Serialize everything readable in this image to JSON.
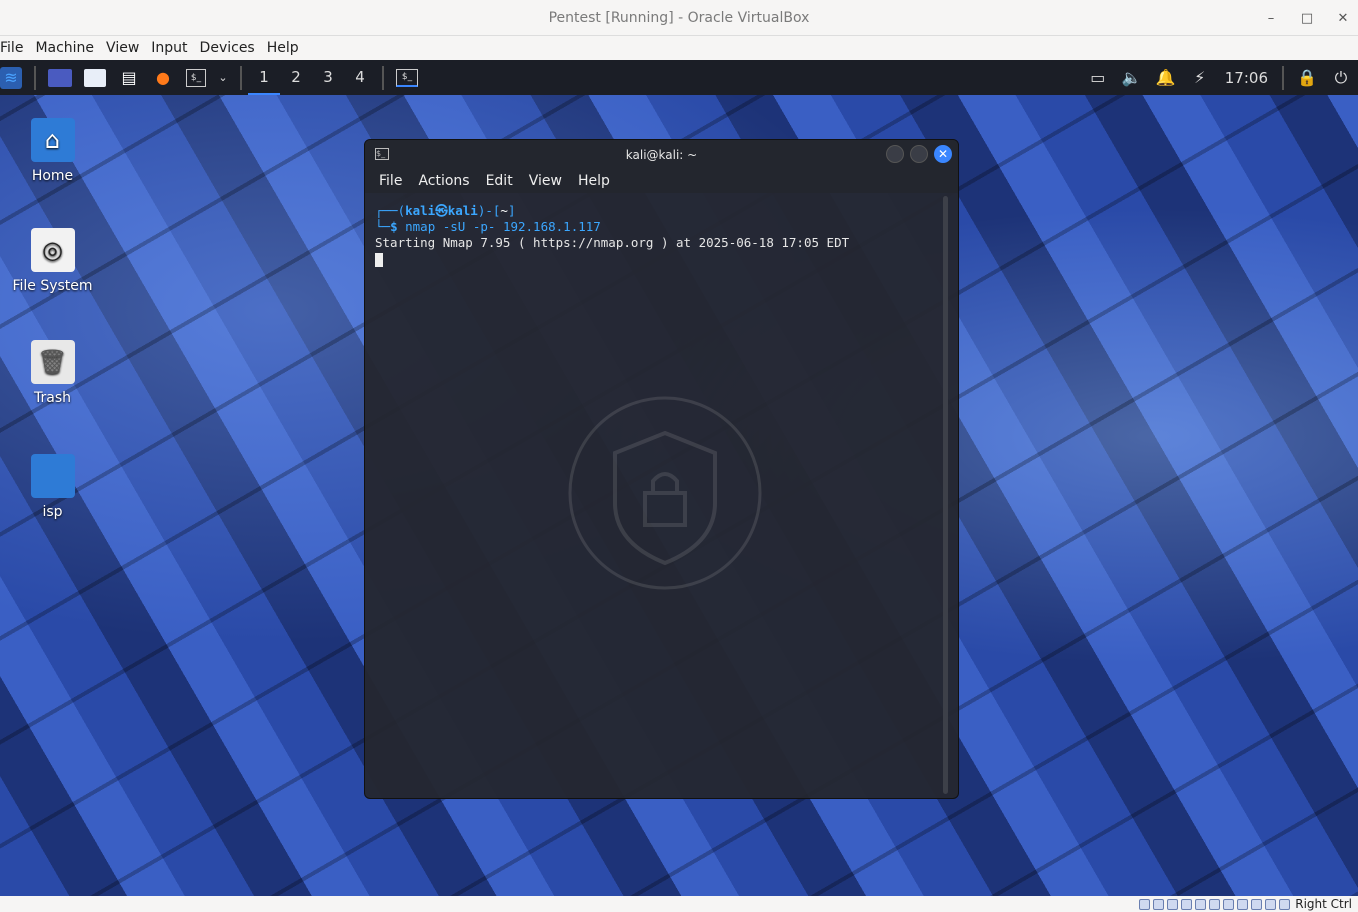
{
  "vbox": {
    "title": "Pentest [Running] - Oracle VirtualBox",
    "menu": [
      "File",
      "Machine",
      "View",
      "Input",
      "Devices",
      "Help"
    ],
    "host_key": "Right Ctrl"
  },
  "panel": {
    "workspaces": [
      "1",
      "2",
      "3",
      "4"
    ],
    "active_workspace": "1",
    "clock": "17:06"
  },
  "desktop": {
    "icons": [
      "Home",
      "File System",
      "Trash",
      "isp"
    ]
  },
  "terminal": {
    "title": "kali@kali: ~",
    "menu": [
      "File",
      "Actions",
      "Edit",
      "View",
      "Help"
    ],
    "prompt_user": "kali",
    "prompt_host": "kali",
    "prompt_dir": "~",
    "command": "nmap -sU -p- 192.168.1.117",
    "output": "Starting Nmap 7.95 ( https://nmap.org ) at 2025-06-18 17:05 EDT"
  },
  "colors": {
    "accent": "#3a86ff",
    "terminal_bg": "#242730",
    "panel_bg": "#1b1e26"
  }
}
